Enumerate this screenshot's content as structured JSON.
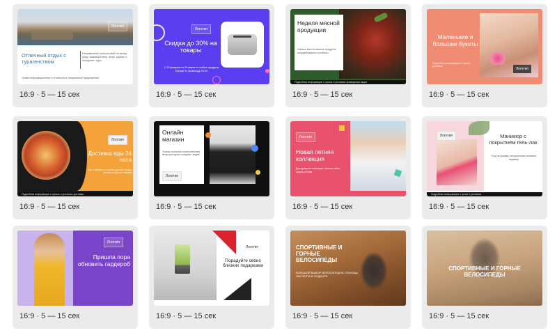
{
  "card_meta": "16:9 · 5 — 15 сек",
  "logo_label": "Логотип",
  "templates": [
    {
      "heading": "Отличный отдых с турагенством",
      "body": "Направление путешествий по всему миру. Авиаперелеты, визы, круизы и экскурсии, туры",
      "fine": "Тонкие информационные о стоимости и специальные предложения",
      "colors": {
        "accent": "#3b6fb0",
        "bg": "#ffffff"
      }
    },
    {
      "heading": "Скидка до 30% на товары",
      "body": "С 20 февраля по 20 марта на любые продукты бренда по промокоду XXXX",
      "colors": {
        "bg": "#5b3ef0",
        "text": "#ffffff"
      }
    },
    {
      "heading": "Неделя мясной продукции",
      "body": "Свежее мясо и мясные продукты, полуфабрикаты и колбасы",
      "fine": "Подробная информация о сроках и условиях проведения акции",
      "colors": {
        "bg": "#2f5b2a",
        "panel": "#ffffff"
      }
    },
    {
      "heading": "Маленькие и большие букеты",
      "fine": "Подробная информация о сроках доставки",
      "colors": {
        "bg": "#f08c74",
        "text": "#ffffff"
      }
    },
    {
      "heading": "Доставка еды 24 часа",
      "body": "Мы с любовью готовим для вас пиццу, роллы и горячие закуски",
      "fine": "Подробная информация о сроках и условиях доставки",
      "colors": {
        "bg": "#1a1a1a",
        "accent": "#f4a23c"
      }
    },
    {
      "heading": "Онлайн магазин",
      "body": "Только стильные и качественные вещи для ярких и модных людей",
      "colors": {
        "bg": "#0f0f0f",
        "panel": "#ffffff"
      }
    },
    {
      "heading": "Новая летняя коллекция",
      "body": "Для девушек и женщин: платья, юбки, шорты и топы",
      "colors": {
        "bg": "#e8526c",
        "text": "#ffffff"
      }
    },
    {
      "heading": "Маникюр с покрытием гель-лак",
      "body": "Уход за руками, натуральный маникюр, педикюр",
      "fine": "Подробная информация о ценах и условиях",
      "colors": {
        "bg": "#ffffff",
        "accent": "#e84f75"
      }
    },
    {
      "heading": "Пришла пора обновить гардероб",
      "colors": {
        "bg": "#7b45c9",
        "text": "#ffffff"
      }
    },
    {
      "heading": "Порадуйте своих близких подарками",
      "colors": {
        "bg": "#ffffff",
        "accent": "#d9232e"
      }
    },
    {
      "heading": "СПОРТИВНЫЕ И ГОРНЫЕ ВЕЛОСИПЕДЫ",
      "body": "БОЛЬШОЙ ВЫБОР ВЕЛОСИПЕДОВ, ПОМОЩЬ ЭКСПЕРТА В ПОДБОРЕ",
      "colors": {
        "bg": "#a56b3a",
        "text": "#ffffff"
      }
    },
    {
      "heading": "СПОРТИВНЫЕ И ГОРНЫЕ ВЕЛОСИПЕДЫ",
      "colors": {
        "bg": "#c8a37d",
        "text": "#ffffff"
      }
    }
  ]
}
